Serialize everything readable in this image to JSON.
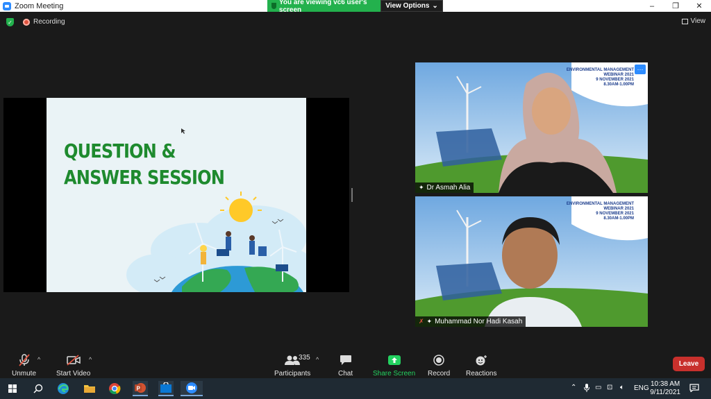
{
  "window": {
    "title": "Zoom Meeting",
    "controls": [
      "–",
      "❐",
      "✕"
    ]
  },
  "banner": {
    "viewing_text": "You are viewing vc6 user's screen",
    "options_label": "View Options"
  },
  "meeting": {
    "recording_label": "Recording",
    "view_label": "View"
  },
  "slide": {
    "title_line1": "QUESTION &",
    "title_line2": "ANSWER SESSION"
  },
  "participants_tiles": [
    {
      "name": "Dr Asmah Alia",
      "more_label": "···",
      "banner_lines": [
        "ENVIRONMENTAL MANAGEMENT",
        "WEBINAR 2021",
        "9 NOVEMBER 2021",
        "8.30AM-1.00PM"
      ]
    },
    {
      "name": "Muhammad Nor Hadi Kasah",
      "banner_lines": [
        "ENVIRONMENTAL MANAGEMENT",
        "WEBINAR 2021",
        "9 NOVEMBER 2021",
        "8.30AM-1.00PM"
      ]
    }
  ],
  "toolbar": {
    "unmute_label": "Unmute",
    "start_video_label": "Start Video",
    "participants_label": "Participants",
    "participants_count": "335",
    "chat_label": "Chat",
    "share_screen_label": "Share Screen",
    "record_label": "Record",
    "reactions_label": "Reactions",
    "leave_label": "Leave"
  },
  "taskbar": {
    "time": "10:38 AM",
    "date": "9/11/2021",
    "language": "ENG"
  },
  "colors": {
    "zoom_blue": "#2d8cff",
    "share_green": "#23d160",
    "leave_red": "#c8302c",
    "banner_green": "#23b14d"
  }
}
